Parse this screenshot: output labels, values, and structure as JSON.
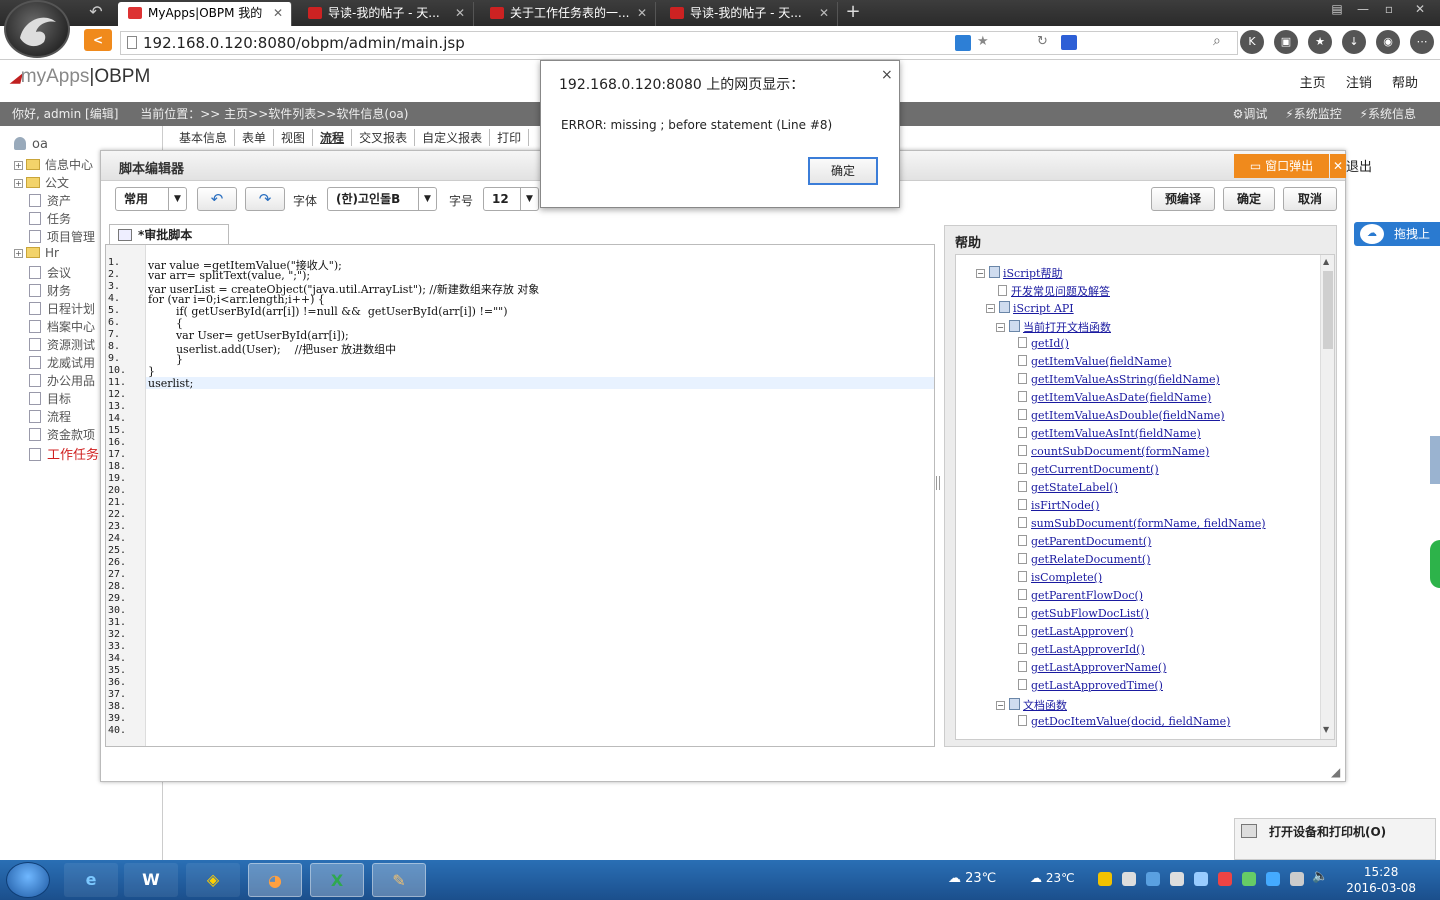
{
  "browser": {
    "tabs": [
      {
        "label": "MyApps|OBPM 我的",
        "active": true
      },
      {
        "label": "导读-我的帖子 - 天...",
        "active": false
      },
      {
        "label": "关于工作任务表的一...",
        "active": false
      },
      {
        "label": "导读-我的帖子 - 天...",
        "active": false
      }
    ],
    "url": "192.168.0.120:8080/obpm/admin/main.jsp"
  },
  "app": {
    "brand_my": "my",
    "brand_apps": "Apps",
    "brand_sep": "|",
    "brand_obpm": "OBPM",
    "nav": [
      "主页",
      "注销",
      "帮助"
    ],
    "greeting": "你好, admin [编辑]",
    "location": "当前位置：>> 主页>>软件列表>>软件信息(oa)",
    "tools": [
      "调试",
      "系统监控",
      "系统信息"
    ],
    "exit": "退出"
  },
  "sidebar": {
    "root": "oa",
    "items": [
      "信息中心",
      "公文",
      "资产",
      "任务",
      "项目管理",
      "Hr",
      "会议",
      "财务",
      "日程计划",
      "档案中心",
      "资源测试",
      "龙威试用",
      "办公用品",
      "目标",
      "流程",
      "资金款项",
      "工作任务"
    ]
  },
  "module_tabs": [
    "基本信息",
    "表单",
    "视图",
    "流程",
    "交叉报表",
    "自定义报表",
    "打印"
  ],
  "editor": {
    "title": "脚本编辑器",
    "popout": "窗口弹出",
    "mode": "常用",
    "font_label": "字体",
    "font_value": "(한)고인돌B",
    "size_label": "字号",
    "size_value": "12",
    "buttons": [
      "预编译",
      "确定",
      "取消"
    ],
    "tab": "*审批脚本",
    "line_count": 40,
    "code": [
      "var value =getItemValue(\"接收人\");",
      "var arr= splitText(value, \";\");",
      "var userList = createObject(\"java.util.ArrayList\"); //新建数组来存放 对象",
      "for (var i=0;i<arr.length;i++) {",
      "        if( getUserById(arr[i]) !=null &&  getUserById(arr[i]) !=\"\")",
      "        {",
      "        var User= getUserById(arr[i]);",
      "        userlist.add(User);    //把user 放进数组中",
      "        }",
      "}",
      "userlist;"
    ]
  },
  "help": {
    "title": "帮助",
    "items": [
      {
        "text": "iScript帮助",
        "level": 0,
        "type": "book"
      },
      {
        "text": "开发常见问题及解答",
        "level": 1,
        "type": "doc"
      },
      {
        "text": "iScript API",
        "level": 1,
        "type": "book"
      },
      {
        "text": "当前打开文档函数",
        "level": 2,
        "type": "book"
      },
      {
        "text": "getId()",
        "level": 3,
        "type": "doc"
      },
      {
        "text": "getItemValue(fieldName)",
        "level": 3,
        "type": "doc"
      },
      {
        "text": "getItemValueAsString(fieldName)",
        "level": 3,
        "type": "doc"
      },
      {
        "text": "getItemValueAsDate(fieldName)",
        "level": 3,
        "type": "doc"
      },
      {
        "text": "getItemValueAsDouble(fieldName)",
        "level": 3,
        "type": "doc"
      },
      {
        "text": "getItemValueAsInt(fieldName)",
        "level": 3,
        "type": "doc"
      },
      {
        "text": "countSubDocument(formName)",
        "level": 3,
        "type": "doc"
      },
      {
        "text": "getCurrentDocument()",
        "level": 3,
        "type": "doc"
      },
      {
        "text": "getStateLabel()",
        "level": 3,
        "type": "doc"
      },
      {
        "text": "isFirtNode()",
        "level": 3,
        "type": "doc"
      },
      {
        "text": "sumSubDocument(formName, fieldName)",
        "level": 3,
        "type": "doc"
      },
      {
        "text": "getParentDocument()",
        "level": 3,
        "type": "doc"
      },
      {
        "text": "getRelateDocument()",
        "level": 3,
        "type": "doc"
      },
      {
        "text": "isComplete()",
        "level": 3,
        "type": "doc"
      },
      {
        "text": "getParentFlowDoc()",
        "level": 3,
        "type": "doc"
      },
      {
        "text": "getSubFlowDocList()",
        "level": 3,
        "type": "doc"
      },
      {
        "text": "getLastApprover()",
        "level": 3,
        "type": "doc"
      },
      {
        "text": "getLastApproverId()",
        "level": 3,
        "type": "doc"
      },
      {
        "text": "getLastApproverName()",
        "level": 3,
        "type": "doc"
      },
      {
        "text": "getLastApprovedTime()",
        "level": 3,
        "type": "doc"
      },
      {
        "text": "文档函数",
        "level": 2,
        "type": "book"
      },
      {
        "text": "getDocItemValue(docid, fieldName)",
        "level": 3,
        "type": "doc"
      }
    ]
  },
  "drag_upload": "拖拽上传",
  "alert": {
    "title": "192.168.0.120:8080 上的网页显示：",
    "message": "ERROR: missing ; before statement (Line #8)",
    "ok": "确定",
    "close": "×"
  },
  "printer_popup": "打开设备和打印机(O)",
  "taskbar": {
    "weather1": "23℃",
    "weather2": "23℃",
    "time": "15:28",
    "date": "2016-03-08"
  },
  "colors": {
    "accent": "#f08a1c",
    "chrome_dark": "#2a2a2a",
    "taskbar": "#1b4f8c",
    "link": "#1a1aa0"
  }
}
